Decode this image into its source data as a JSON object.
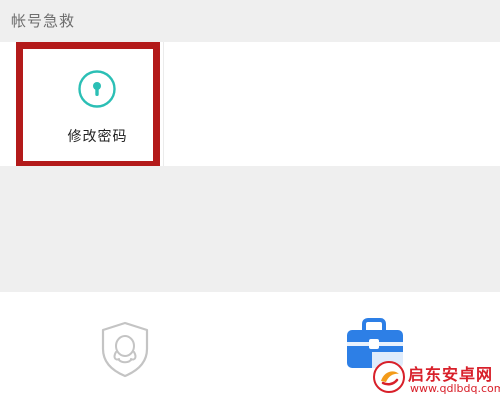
{
  "section": {
    "title": "帐号急救"
  },
  "grid": {
    "items": [
      {
        "label": "修改密码",
        "icon": "keyhole-icon"
      }
    ]
  },
  "tabbar": {
    "tabs": [
      {
        "icon": "qq-shield-icon"
      },
      {
        "icon": "toolbox-icon"
      }
    ]
  },
  "watermark": {
    "name": "启东安卓网",
    "url": "www.qdlbdq.com"
  },
  "colors": {
    "accent_teal": "#2bbfb5",
    "highlight_red": "#b31a1a",
    "toolbox_blue": "#2d7fe6"
  }
}
